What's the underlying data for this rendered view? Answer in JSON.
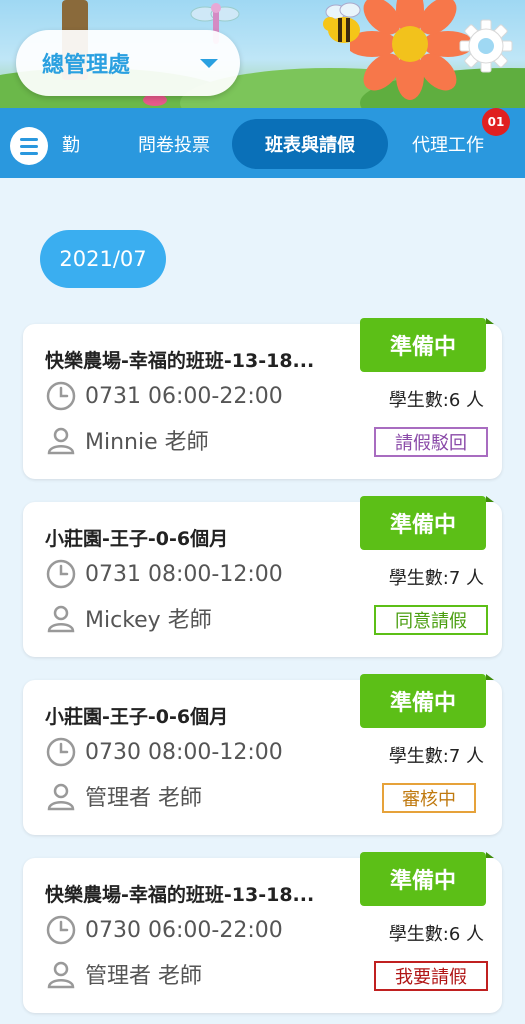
{
  "header": {
    "org_selector": "總管理處"
  },
  "tabs": [
    {
      "label": "勤"
    },
    {
      "label": "問卷投票"
    },
    {
      "label": "班表與請假"
    },
    {
      "label": "代理工作"
    }
  ],
  "agent_badge": "01",
  "month": "2021/07",
  "cards": [
    {
      "title": "快樂農場-幸福的班班-13-18...",
      "status": "準備中",
      "time": "0731 06:00-22:00",
      "teacher": "Minnie 老師",
      "students": "學生數:6 人",
      "leave_action": "請假駁回",
      "leave_color": "#8a4aa8"
    },
    {
      "title": "小莊園-王子-0-6個月",
      "status": "準備中",
      "time": "0731 08:00-12:00",
      "teacher": "Mickey 老師",
      "students": "學生數:7 人",
      "leave_action": "同意請假",
      "leave_color": "#4a9e10"
    },
    {
      "title": "小莊園-王子-0-6個月",
      "status": "準備中",
      "time": "0730 08:00-12:00",
      "teacher": "管理者 老師",
      "students": "學生數:7 人",
      "leave_action": "審核中",
      "leave_color": "#c07a10"
    },
    {
      "title": "快樂農場-幸福的班班-13-18...",
      "status": "準備中",
      "time": "0730 06:00-22:00",
      "teacher": "管理者 老師",
      "students": "學生數:6 人",
      "leave_action": "我要請假",
      "leave_color": "#b01515"
    }
  ],
  "colors": {
    "tab_bar": "#2a98de",
    "active_tab": "#0a70b8",
    "status_green": "#5cbf17",
    "month_pill": "#3aaef0",
    "badge_red": "#e02020"
  },
  "icons": {
    "menu": "hamburger-icon",
    "settings": "gear-icon",
    "clock": "clock-icon",
    "teacher": "person-icon",
    "dropdown": "caret-down-icon"
  }
}
